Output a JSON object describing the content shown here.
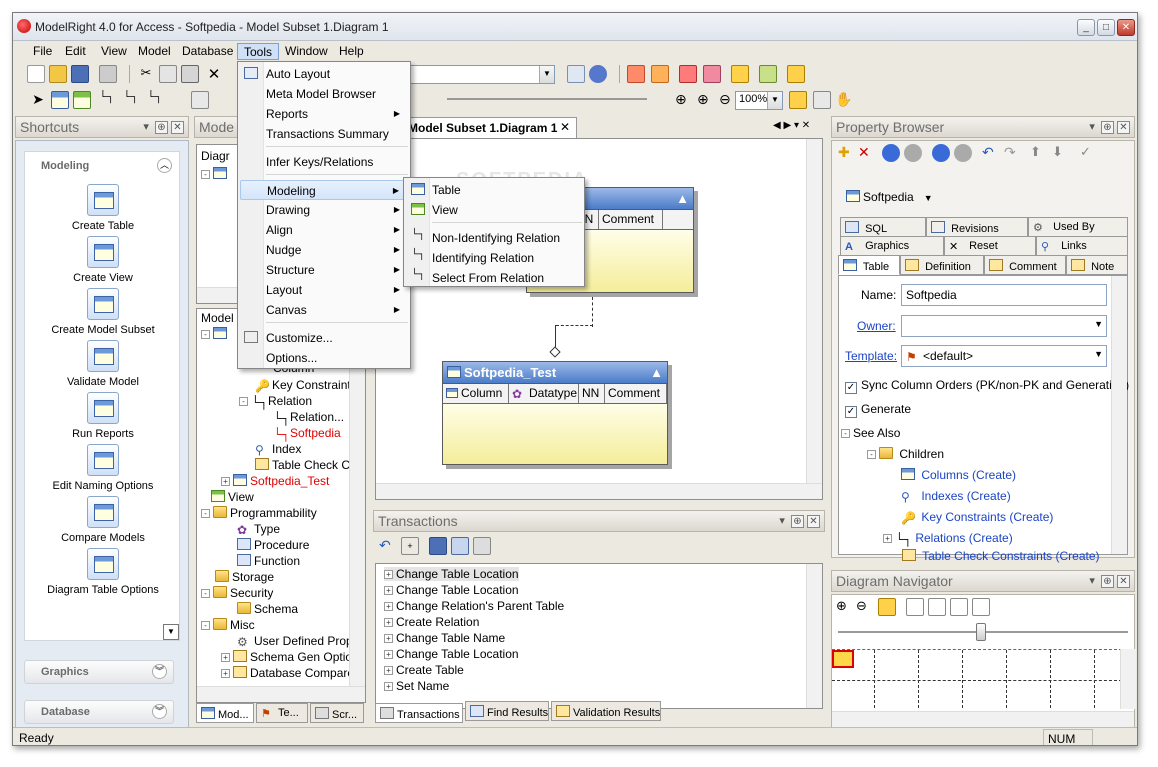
{
  "window": {
    "title": "ModelRight 4.0 for Access - Softpedia - Model Subset 1.Diagram 1"
  },
  "menubar": [
    "File",
    "Edit",
    "View",
    "Model",
    "Database",
    "Tools",
    "Window",
    "Help"
  ],
  "toolbar": {
    "zoom_value": "100%"
  },
  "shortcuts": {
    "title": "Shortcuts",
    "group_modeling": "Modeling",
    "items": [
      "Create Table",
      "Create View",
      "Create Model Subset",
      "Validate Model",
      "Run Reports",
      "Edit Naming Options",
      "Compare Models",
      "Diagram Table Options"
    ],
    "group_graphics": "Graphics",
    "group_database": "Database"
  },
  "model_panel": {
    "title": "Mode",
    "top_label": "Diagr",
    "bottom_label": "Model",
    "tree": [
      "Column",
      "Key Constraint",
      "Relation",
      "Relation...",
      "Softpedia",
      "Index",
      "Table Check Co",
      "Softpedia_Test",
      "View",
      "Programmability",
      "Type",
      "Procedure",
      "Function",
      "Storage",
      "Security",
      "Schema",
      "Misc",
      "User Defined Prop...",
      "Schema Gen Option",
      "Database Compare"
    ],
    "tabs": [
      "Mod...",
      "Te...",
      "Scr..."
    ]
  },
  "tools_menu": {
    "items": [
      "Auto Layout",
      "Meta Model Browser",
      "Reports",
      "Transactions Summary",
      "Infer Keys/Relations",
      "Modeling",
      "Drawing",
      "Align",
      "Nudge",
      "Structure",
      "Layout",
      "Canvas",
      "Customize...",
      "Options..."
    ]
  },
  "modeling_submenu": {
    "items": [
      "Table",
      "View",
      "Non-Identifying Relation",
      "Identifying Relation",
      "Select From Relation"
    ]
  },
  "diagram": {
    "tab_label": "Model Subset 1.Diagram 1",
    "watermark": "SOFTPEDIA",
    "entity1": {
      "cols": [
        "ype",
        "NN",
        "Comment"
      ]
    },
    "entity2": {
      "name": "Softpedia_Test",
      "cols": [
        "Column",
        "Datatype",
        "NN",
        "Comment"
      ]
    }
  },
  "transactions": {
    "title": "Transactions",
    "items": [
      "Change Table Location",
      "Change Table Location",
      "Change Relation's Parent Table",
      "Create Relation",
      "Change Table Name",
      "Change Table Location",
      "Create Table",
      "Set Name"
    ],
    "tabs": [
      "Transactions",
      "Find Results",
      "Validation Results"
    ]
  },
  "property_browser": {
    "title": "Property Browser",
    "object": "Softpedia",
    "tabs_row1": [
      "SQL",
      "Revisions",
      "Used By"
    ],
    "tabs_row2": [
      "Graphics",
      "Reset",
      "Links"
    ],
    "tabs_row3": [
      "Table",
      "Definition",
      "Comment",
      "Note"
    ],
    "name_label": "Name:",
    "name_value": "Softpedia",
    "owner_label": "Owner:",
    "owner_value": "",
    "template_label": "Template:",
    "template_value": "<default>",
    "sync_label": "Sync Column Orders (PK/non-PK and Generation)",
    "generate_label": "Generate",
    "see_also": "See Also",
    "children": "Children",
    "links": [
      "Columns (Create)",
      "Indexes (Create)",
      "Key Constraints (Create)",
      "Relations (Create)",
      "Table Check Constraints (Create)"
    ]
  },
  "navigator": {
    "title": "Diagram Navigator"
  },
  "status": {
    "left": "Ready",
    "right": "NUM"
  }
}
